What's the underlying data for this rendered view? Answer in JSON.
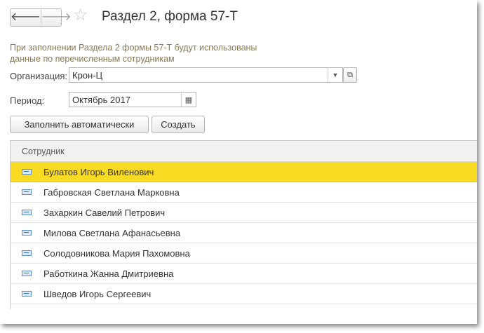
{
  "header": {
    "back_glyph": "🡐",
    "forward_glyph": "🡒",
    "title": "Раздел 2, форма 57-Т"
  },
  "hint": "При заполнении Раздела 2 формы 57-Т будут использованы данные по перечисленным сотрудникам",
  "organization": {
    "label": "Организация:",
    "value": "Крон-Ц"
  },
  "period": {
    "label": "Период:",
    "value": "Октябрь 2017"
  },
  "buttons": {
    "fill_auto": "Заполнить автоматически",
    "create": "Создать"
  },
  "table": {
    "column": "Сотрудник",
    "rows": [
      "Булатов Игорь Виленович",
      "Габровская Светлана Марковна",
      "Захаркин Савелий Петрович",
      "Милова Светлана Афанасьевна",
      "Солодовникова Мария Пахомовна",
      "Работкина Жанна Дмитриевна",
      "Шведов Игорь Сергеевич"
    ],
    "selected_index": 0
  },
  "colors": {
    "selection": "#f9db24",
    "hint_text": "#8a7a52"
  }
}
